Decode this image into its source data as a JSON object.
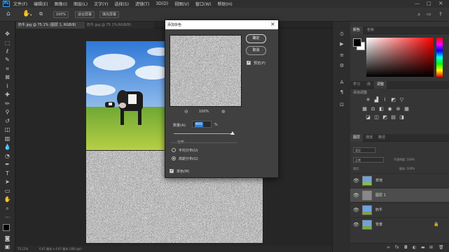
{
  "app": {
    "logo": "Ps"
  },
  "menu": [
    "文件(F)",
    "编辑(E)",
    "图像(I)",
    "图层(L)",
    "文字(Y)",
    "选择(S)",
    "滤镜(T)",
    "3D(D)",
    "视图(V)",
    "窗口(W)",
    "帮助(H)"
  ],
  "options": {
    "zoom": "100%",
    "fit_screen": "适合屏幕",
    "fill_screen": "填充屏幕"
  },
  "tabs": [
    {
      "label": "奶牛.jpg @ 75.1% (图层 1, RGB/8)",
      "close": "×"
    },
    {
      "label": "奶牛.jpg @ 75.1%(RGB/8)",
      "close": "×"
    }
  ],
  "status": {
    "zoom": "75.11%",
    "doc": "6.67 厘米 x 4.67 厘米 (300 ppi)"
  },
  "panels": {
    "color_tabs": [
      "颜色",
      "色板"
    ],
    "adjust_tabs": [
      "学习",
      "库",
      "调整"
    ],
    "adjust_title": "添加调整",
    "layers_tabs": [
      "图层",
      "通道",
      "路径"
    ],
    "kind": "类型",
    "blend": "正常",
    "opacity": "不透明度: 100%",
    "lock": "锁定:",
    "fill": "填充: 100%",
    "layers": [
      {
        "name": "草地",
        "thumb": "photo",
        "selected": false,
        "locked": false
      },
      {
        "name": "图层 1",
        "thumb": "noise",
        "selected": true,
        "locked": false
      },
      {
        "name": "奶牛",
        "thumb": "photo",
        "selected": false,
        "locked": false
      },
      {
        "name": "背景",
        "thumb": "photo",
        "selected": false,
        "locked": true
      }
    ]
  },
  "dialog": {
    "title": "添加杂色",
    "close": "×",
    "ok": "确定",
    "cancel": "取消",
    "preview_label": "预览(P)",
    "preview_checked": true,
    "zoom_out": "⊖",
    "zoom_level": "100%",
    "zoom_in": "⊕",
    "amount_label": "数量(A):",
    "amount_value": "400",
    "amount_unit": "%",
    "amount_slider_fraction": 1.0,
    "dist_label": "分布",
    "uniform": "平均分布(U)",
    "gaussian": "高斯分布(G)",
    "selected_distribution": "gaussian",
    "mono": "单色(M)",
    "mono_checked": true
  },
  "colors": {
    "accent": "#2f7fd8",
    "bg": "#282828",
    "panel": "#353535",
    "fg_swatch": "#000000",
    "bg_swatch": "#ffffff"
  }
}
